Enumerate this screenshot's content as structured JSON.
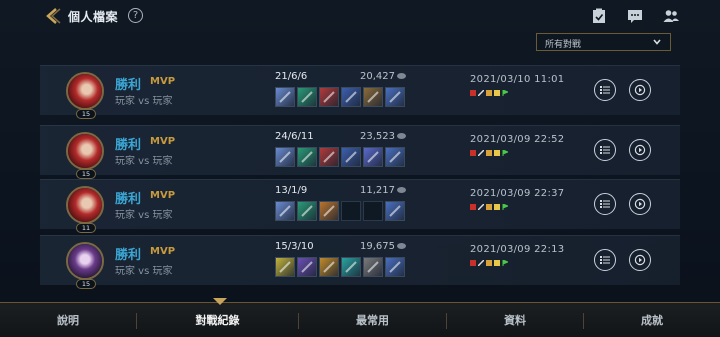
{
  "header": {
    "title": "個人檔案",
    "help_glyph": "?",
    "icons": [
      "back-icon",
      "clipboard-icon",
      "chat-icon",
      "friends-icon"
    ]
  },
  "filter": {
    "selected": "所有對戰"
  },
  "matches": [
    {
      "result": "勝利",
      "mvp": "MVP",
      "mode": "玩家 vs 玩家",
      "level": "15",
      "kda": "21/6/6",
      "gold": "20,427",
      "date": "2021/03/10 11:01",
      "items": [
        "#6a8bd1",
        "#2a9a76",
        "#b03a3a",
        "#3d5fae",
        "#8a6b3a",
        "#4a6fbf"
      ]
    },
    {
      "result": "勝利",
      "mvp": "MVP",
      "mode": "玩家 vs 玩家",
      "level": "15",
      "kda": "24/6/11",
      "gold": "23,523",
      "date": "2021/03/09 22:52",
      "items": [
        "#6a8bd1",
        "#2a9a76",
        "#b03a3a",
        "#3d5fae",
        "#5a6acb",
        "#4a6fbf"
      ]
    },
    {
      "result": "勝利",
      "mvp": "MVP",
      "mode": "玩家 vs 玩家",
      "level": "11",
      "kda": "13/1/9",
      "gold": "11,217",
      "date": "2021/03/09 22:37",
      "items": [
        "#6a8bd1",
        "#2a9a76",
        "#b8742e",
        "",
        "",
        "#4a6fbf"
      ]
    },
    {
      "result": "勝利",
      "mvp": "MVP",
      "mode": "玩家 vs 玩家",
      "level": "15",
      "kda": "15/3/10",
      "gold": "19,675",
      "date": "2021/03/09 22:13",
      "items": [
        "#c2b23a",
        "#6a4fb3",
        "#c08a2a",
        "#2aa3a0",
        "#7a7a7a",
        "#4a6fbf"
      ]
    }
  ],
  "tabs": [
    {
      "label": "說明",
      "active": false
    },
    {
      "label": "對戰紀錄",
      "active": true
    },
    {
      "label": "最常用",
      "active": false
    },
    {
      "label": "資料",
      "active": false
    },
    {
      "label": "成就",
      "active": false
    }
  ],
  "colors": {
    "win": "#3ba6d4",
    "mvp": "#c79a3e",
    "accent_gold": "#6a5530"
  }
}
